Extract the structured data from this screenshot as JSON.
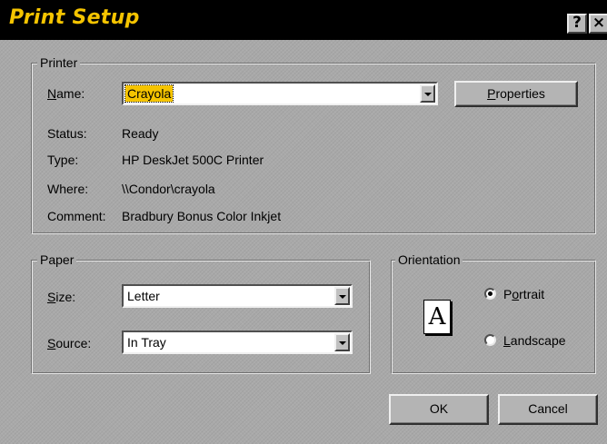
{
  "window": {
    "title": "Print Setup",
    "help_button": "?",
    "close_button": "×"
  },
  "printer": {
    "group_label": "Printer",
    "name_label": "Name:",
    "name_value": "Crayola",
    "properties_button": "Properties",
    "status_label": "Status:",
    "status_value": "Ready",
    "type_label": "Type:",
    "type_value": "HP DeskJet 500C Printer",
    "where_label": "Where:",
    "where_value": "\\\\Condor\\crayola",
    "comment_label": "Comment:",
    "comment_value": "Bradbury Bonus Color Inkjet"
  },
  "paper": {
    "group_label": "Paper",
    "size_label": "Size:",
    "size_value": "Letter",
    "source_label": "Source:",
    "source_value": "In Tray"
  },
  "orientation": {
    "group_label": "Orientation",
    "page_icon_letter": "A",
    "portrait_label": "Portrait",
    "portrait_selected": true,
    "landscape_label": "Landscape",
    "landscape_selected": false
  },
  "buttons": {
    "ok": "OK",
    "cancel": "Cancel"
  },
  "colors": {
    "title_text": "#f5c400",
    "selection_highlight": "#f5c400",
    "dialog_background": "#a9a9a9",
    "titlebar_background": "#000000"
  }
}
